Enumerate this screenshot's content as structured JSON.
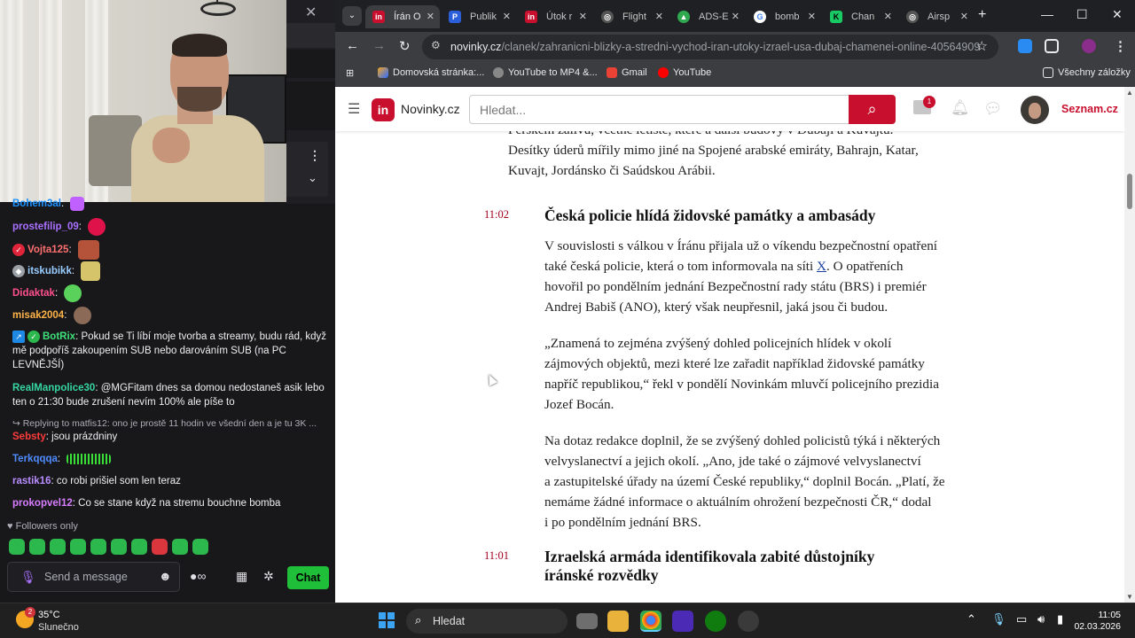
{
  "stream": {
    "close_glyph": "✕",
    "kebab_glyph": "⋮",
    "chevron_glyph": "⌄"
  },
  "chat": {
    "lines": [
      {
        "user": "Bohem3al",
        "color": "#1e90ff",
        "text": ""
      },
      {
        "user": "prostefilip_09",
        "color": "#a970ff",
        "text": ""
      },
      {
        "user": "Vojta125",
        "color": "#ff6f6f",
        "text": ""
      },
      {
        "user": "itskubikk",
        "color": "#9cf",
        "text": ""
      },
      {
        "user": "Didaktak",
        "color": "#ff4f8b",
        "text": ""
      },
      {
        "user": "misak2004",
        "color": "#ffb347",
        "text": ""
      }
    ],
    "botrix": {
      "user": "BotRix",
      "color": "#3fe07a",
      "text": "Pokud se Ti líbí moje tvorba a streamy, budu rád, když mě podpoříš zakoupením SUB nebo darováním SUB (na PC LEVNĚJŠÍ)"
    },
    "realman": {
      "user": "RealManpolice30",
      "color": "#35d6a0",
      "text": "@MGFitam dnes sa domou nedostaneš asik lebo ten o 21:30 bude zrušení nevím 100% ale píše to"
    },
    "reply": "Replying to matfis12: ono je prostě 11 hodin ve všední den a je tu 3K ...",
    "sebsty": {
      "user": "Sebsty",
      "color": "#ff3b3b",
      "text": "jsou prázdniny"
    },
    "terk": {
      "user": "Terkqqqa",
      "color": "#4f8cff",
      "text": ""
    },
    "rastik": {
      "user": "rastik16",
      "color": "#b98cff",
      "text": "co robi prišiel som len teraz"
    },
    "prokop": {
      "user": "prokopvel12",
      "color": "#d77dff",
      "text": "Co se stane když na stremu bouchne bomba"
    },
    "followers": "Followers only",
    "placeholder": "Send a message",
    "chat_button": "Chat"
  },
  "browser": {
    "tabs": [
      {
        "label": "Írán O",
        "fav": "in",
        "fav_color": "#c8102e",
        "active": true
      },
      {
        "label": "Publik",
        "fav": "P",
        "fav_color": "#2b5fd9",
        "active": false
      },
      {
        "label": "Útok r",
        "fav": "in",
        "fav_color": "#c8102e",
        "active": false
      },
      {
        "label": "Flight",
        "fav": "◎",
        "fav_color": "#555",
        "active": false
      },
      {
        "label": "ADS-E",
        "fav": "▲",
        "fav_color": "#2fa84f",
        "active": false
      },
      {
        "label": "bomb",
        "fav": "G",
        "fav_color": "#4285f4",
        "active": false
      },
      {
        "label": "Chan",
        "fav": "K",
        "fav_color": "#18c964",
        "active": false
      },
      {
        "label": "Airsp",
        "fav": "◎",
        "fav_color": "#555",
        "active": false
      }
    ],
    "url_host": "novinky.cz",
    "url_path": "/clanek/zahranicni-blizky-a-stredni-vychod-iran-utoky-izrael-usa-dubaj-chamenei-online-40564909",
    "bookmarks": [
      "Domovská stránka:...",
      "YouTube to MP4 &...",
      "Gmail",
      "YouTube"
    ],
    "all_bookmarks": "Všechny záložky"
  },
  "site": {
    "brand": "Novinky.cz",
    "search_placeholder": "Hledat...",
    "mail_count": "1",
    "portal": "Seznam.cz"
  },
  "article": {
    "top_lines": [
      "Perskem zálivu, včetně letiště, které a další budovy v Dubaji a Kuvajtu.",
      "Desítky úderů mířily mimo jiné na Spojené arabské emiráty, Bahrajn, Katar,",
      "Kuvajt, Jordánsko či Saúdskou Arábii."
    ],
    "entry1": {
      "time": "11:02",
      "title": "Česká policie hlídá židovské památky a ambasády",
      "p1": [
        "V souvislosti s válkou v Íránu přijala už o víkendu bezpečnostní opatření",
        "také česká policie, která o tom informovala na síti ",
        "hovořil po pondělním jednání Bezpečnostní rady státu (BRS) i premiér",
        "Andrej Babiš (ANO), který však neupřesnil, jaká jsou či budou."
      ],
      "link": "X",
      "p1_tail": ". O opatřeních",
      "p2": [
        "„Znamená to zejména zvýšený dohled policejních hlídek v okolí",
        "zájmových objektů, mezi které lze zařadit například židovské památky",
        "napříč republikou,“ řekl v pondělí Novinkám mluvčí policejního prezidia",
        "Jozef Bocán."
      ],
      "p3": [
        "Na dotaz redakce doplnil, že se zvýšený dohled policistů týká i některých",
        "velvyslanectví a jejich okolí. „Ano, jde také o zájmové velvyslanectví",
        "a zastupitelské úřady na území České republiky,“ doplnil Bocán. „Platí, že",
        "nemáme žádné informace o aktuálním ohrožení bezpečnosti ČR,“ dodal",
        "i po pondělním jednání BRS."
      ]
    },
    "entry2": {
      "time": "11:01",
      "title_l1": "Izraelská armáda identifikovala zabité důstojníky",
      "title_l2": "íránské rozvědky"
    }
  },
  "taskbar": {
    "temp": "35°C",
    "weather": "Slunečno",
    "weather_badge": "2",
    "search": "Hledat",
    "time": "11:05",
    "date": "02.03.2026"
  }
}
